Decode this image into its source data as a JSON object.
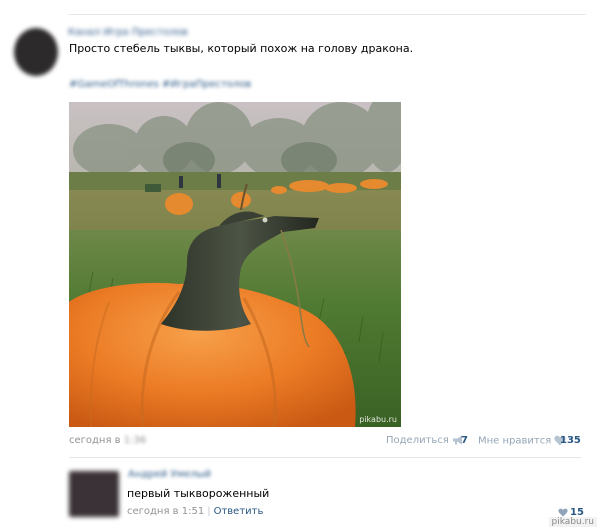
{
  "post": {
    "author_name": "Канал Игра Престолов",
    "text": "Просто стебель тыквы, который похож на голову дракона.",
    "hashtags": "#GameOfThrones #ИграПрестолов",
    "photo_watermark": "pikabu.ru",
    "date_prefix": "сегодня в",
    "date_time": "1:36",
    "share_label": "Поделиться",
    "share_count": "7",
    "like_label": "Мне нравится",
    "like_count": "135",
    "icons": {
      "share": "megaphone-icon",
      "like": "heart-icon"
    }
  },
  "comment": {
    "author_name": "Андрей Умелый",
    "text": "первый тыквороженный",
    "date": "сегодня в 1:51",
    "separator": "|",
    "reply_label": "Ответить",
    "like_count": "15",
    "like_icon": "heart-icon"
  },
  "site_watermark": "pikabu.ru",
  "colors": {
    "link": "#2a5885",
    "muted": "#939393",
    "action": "#95a6b6"
  }
}
